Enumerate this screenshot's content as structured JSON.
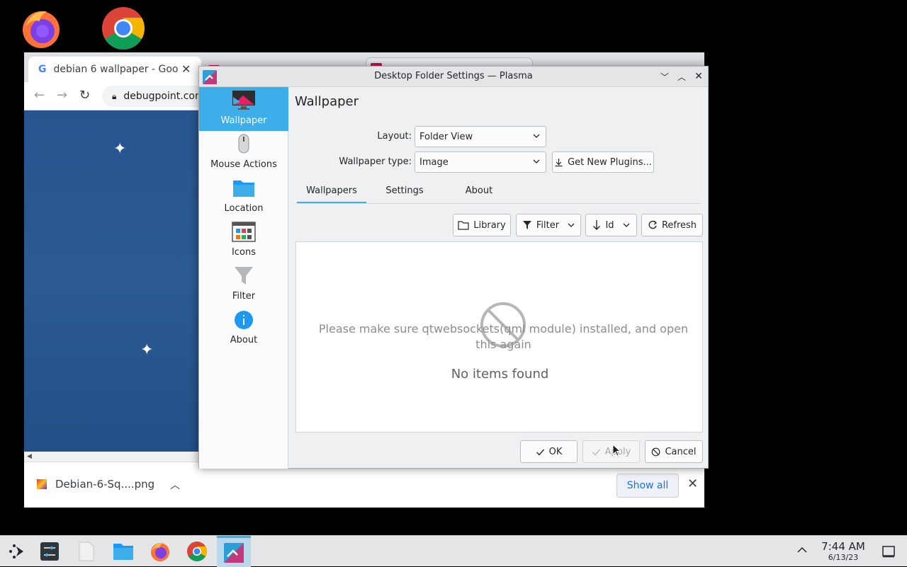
{
  "desktop": {
    "icons": [
      "firefox-icon",
      "chrome-icon"
    ]
  },
  "chrome": {
    "tab_title": "debian 6 wallpaper - Goo",
    "url": "debugpoint.com",
    "download_filename": "Debian-6-Sq....png",
    "show_all_label": "Show all"
  },
  "dialog": {
    "title": "Desktop Folder Settings — Plasma",
    "sidebar": {
      "items": [
        {
          "label": "Wallpaper"
        },
        {
          "label": "Mouse Actions"
        },
        {
          "label": "Location"
        },
        {
          "label": "Icons"
        },
        {
          "label": "Filter"
        },
        {
          "label": "About"
        }
      ]
    },
    "heading": "Wallpaper",
    "layout_label": "Layout:",
    "layout_value": "Folder View",
    "wallpaper_type_label": "Wallpaper type:",
    "wallpaper_type_value": "Image",
    "get_plugins_label": "Get New Plugins...",
    "tabs": [
      {
        "label": "Wallpapers"
      },
      {
        "label": "Settings"
      },
      {
        "label": "About"
      }
    ],
    "toolbar": {
      "library": "Library",
      "filter": "Filter",
      "sort": "Id",
      "refresh": "Refresh"
    },
    "message": "Please make sure qtwebsockets(qml module) installed, and open this again",
    "empty_text": "No items found",
    "buttons": {
      "ok": "OK",
      "apply": "Apply",
      "cancel": "Cancel"
    }
  },
  "taskbar": {
    "time": "7:44 AM",
    "date": "6/13/23"
  },
  "colors": {
    "accent": "#3daee9",
    "sidebar_selected": "#3daee9",
    "wallpaper_blue": "#2a5690"
  }
}
